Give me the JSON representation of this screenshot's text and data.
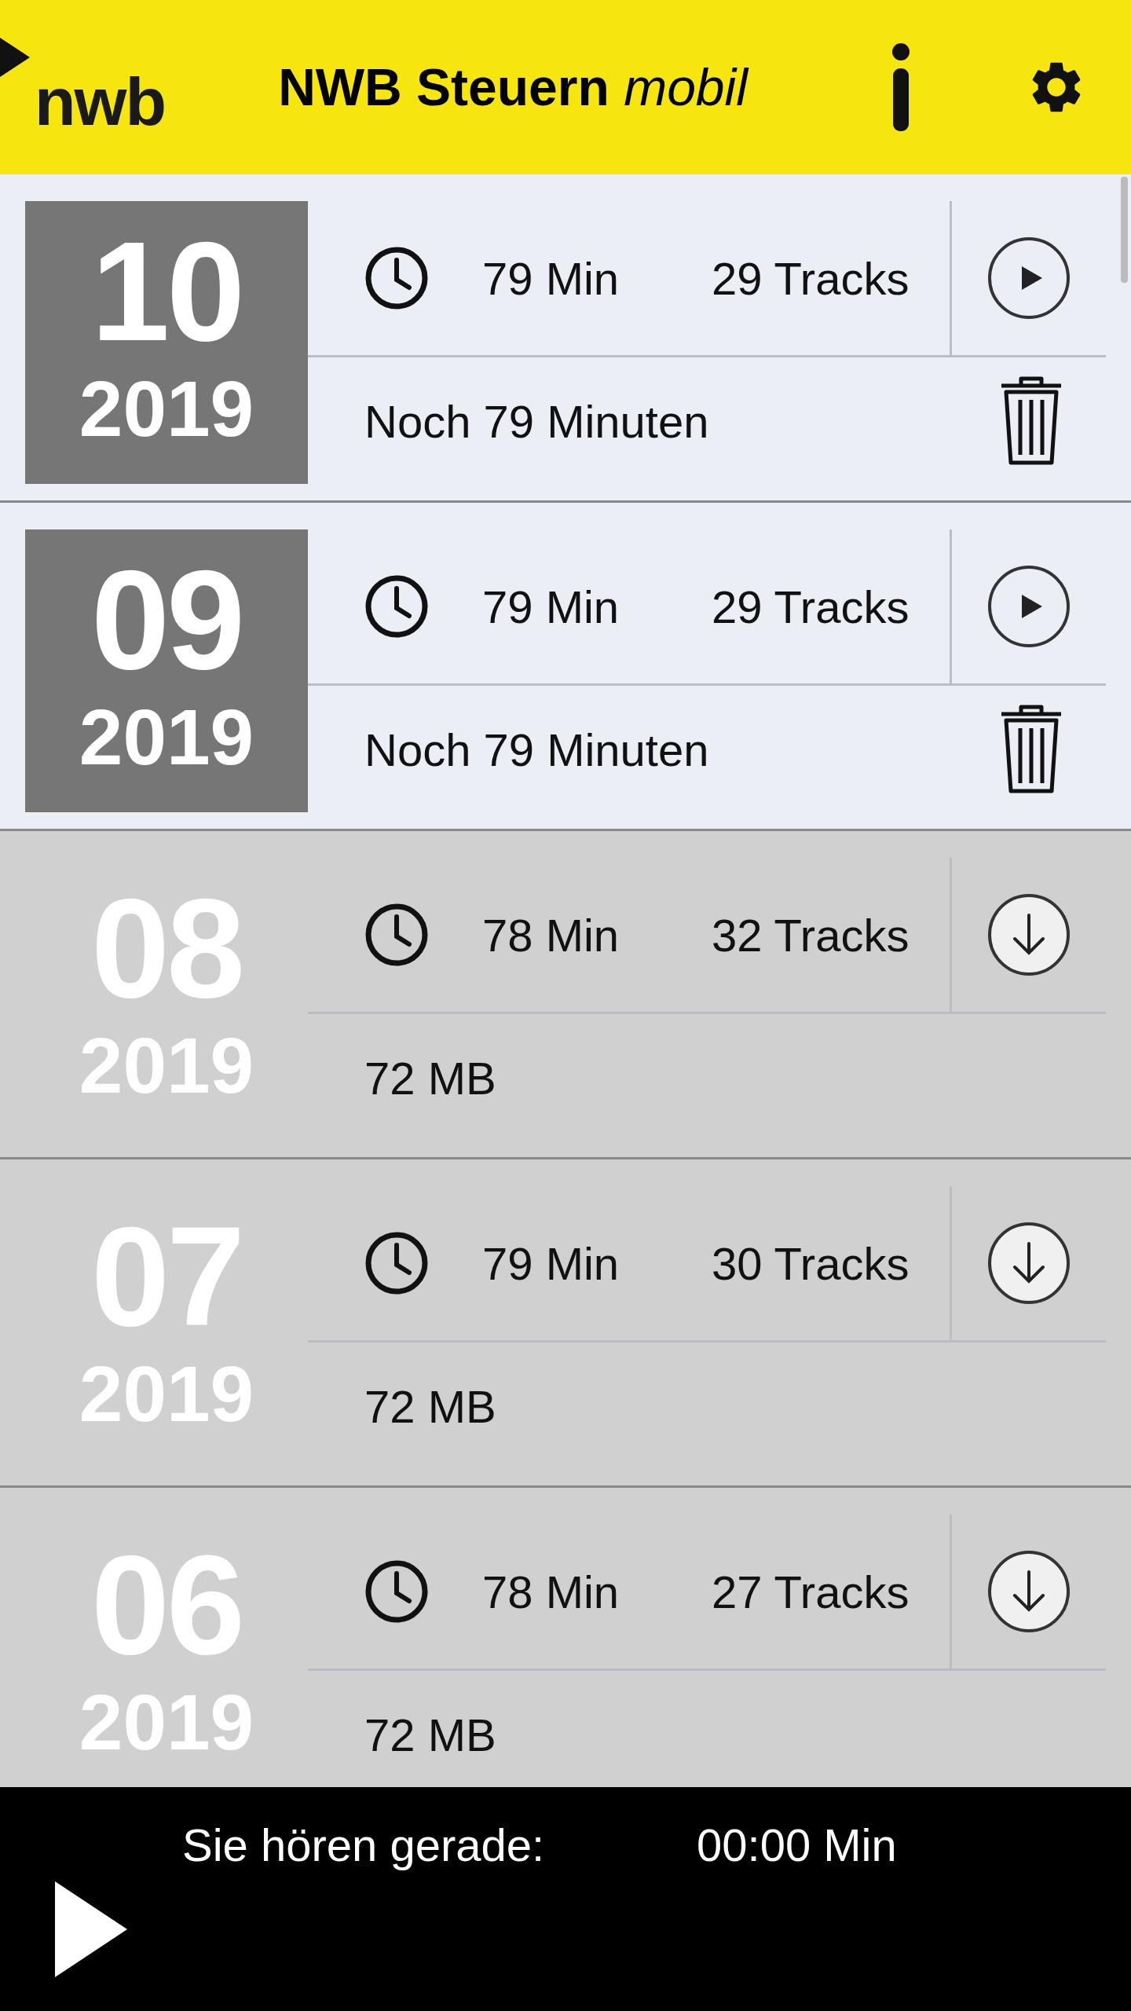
{
  "header": {
    "logo": "nwb",
    "title": "NWB Steuern",
    "title_emphasis": "mobil"
  },
  "issues": [
    {
      "kind": "downloaded",
      "month": "10",
      "year": "2019",
      "duration": "79 Min",
      "tracks": "29 Tracks",
      "detail": "Noch 79 Minuten"
    },
    {
      "kind": "downloaded",
      "month": "09",
      "year": "2019",
      "duration": "79 Min",
      "tracks": "29 Tracks",
      "detail": "Noch 79 Minuten"
    },
    {
      "kind": "available",
      "month": "08",
      "year": "2019",
      "duration": "78 Min",
      "tracks": "32 Tracks",
      "detail": "72 MB"
    },
    {
      "kind": "available",
      "month": "07",
      "year": "2019",
      "duration": "79 Min",
      "tracks": "30 Tracks",
      "detail": "72 MB"
    },
    {
      "kind": "available",
      "month": "06",
      "year": "2019",
      "duration": "78 Min",
      "tracks": "27 Tracks",
      "detail": "72 MB"
    }
  ],
  "player": {
    "label": "Sie hören gerade:",
    "time": "00:00 Min"
  }
}
